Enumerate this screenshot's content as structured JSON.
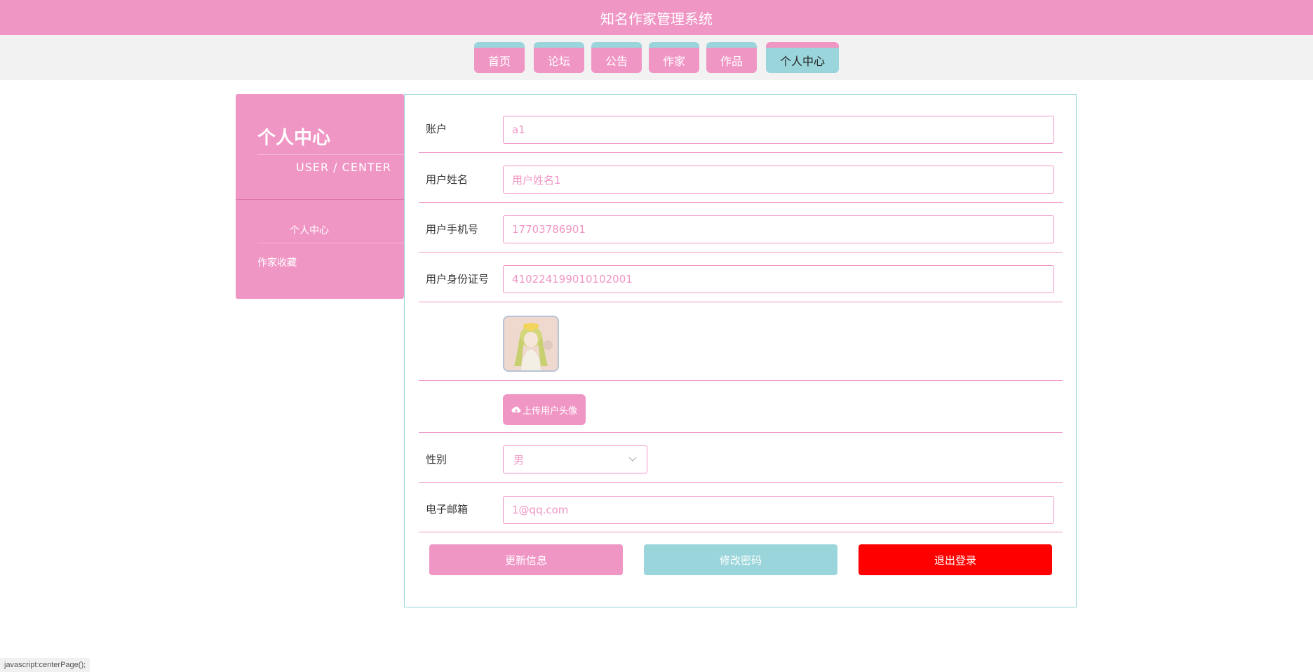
{
  "app": {
    "title": "知名作家管理系统"
  },
  "nav": {
    "items": [
      {
        "label": "首页"
      },
      {
        "label": "论坛"
      },
      {
        "label": "公告"
      },
      {
        "label": "作家"
      },
      {
        "label": "作品"
      },
      {
        "label": "个人中心"
      }
    ],
    "active_index": 5
  },
  "sidebar": {
    "title": "个人中心",
    "subtitle": "USER / CENTER",
    "items": [
      {
        "label": "个人中心"
      },
      {
        "label": "作家收藏"
      }
    ]
  },
  "form": {
    "account": {
      "label": "账户",
      "value": "a1"
    },
    "name": {
      "label": "用户姓名",
      "value": "用户姓名1"
    },
    "phone": {
      "label": "用户手机号",
      "value": "17703786901"
    },
    "idcard": {
      "label": "用户身份证号",
      "value": "410224199010102001"
    },
    "upload_label": "上传用户头像",
    "gender": {
      "label": "性别",
      "value": "男"
    },
    "email": {
      "label": "电子邮箱",
      "value": "1@qq.com"
    }
  },
  "actions": {
    "update": "更新信息",
    "change_password": "修改密码",
    "logout": "退出登录"
  },
  "status_bar": {
    "text": "javascript:centerPage();"
  },
  "colors": {
    "brand_pink": "#f096c5",
    "accent_teal": "#9ad5dc",
    "danger_red": "#ff0000"
  }
}
